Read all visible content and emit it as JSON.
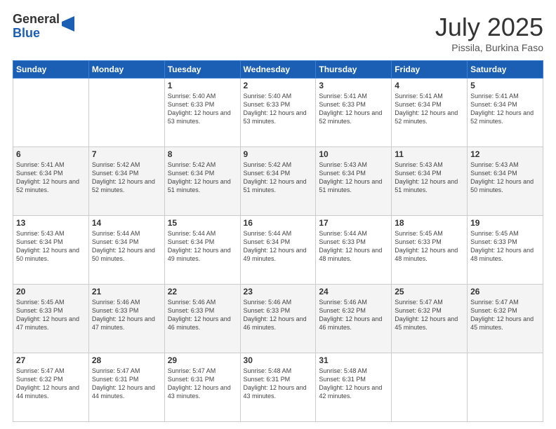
{
  "header": {
    "logo_general": "General",
    "logo_blue": "Blue",
    "month_title": "July 2025",
    "location": "Pissila, Burkina Faso"
  },
  "weekdays": [
    "Sunday",
    "Monday",
    "Tuesday",
    "Wednesday",
    "Thursday",
    "Friday",
    "Saturday"
  ],
  "weeks": [
    [
      {
        "day": "",
        "info": ""
      },
      {
        "day": "",
        "info": ""
      },
      {
        "day": "1",
        "info": "Sunrise: 5:40 AM\nSunset: 6:33 PM\nDaylight: 12 hours and 53 minutes."
      },
      {
        "day": "2",
        "info": "Sunrise: 5:40 AM\nSunset: 6:33 PM\nDaylight: 12 hours and 53 minutes."
      },
      {
        "day": "3",
        "info": "Sunrise: 5:41 AM\nSunset: 6:33 PM\nDaylight: 12 hours and 52 minutes."
      },
      {
        "day": "4",
        "info": "Sunrise: 5:41 AM\nSunset: 6:34 PM\nDaylight: 12 hours and 52 minutes."
      },
      {
        "day": "5",
        "info": "Sunrise: 5:41 AM\nSunset: 6:34 PM\nDaylight: 12 hours and 52 minutes."
      }
    ],
    [
      {
        "day": "6",
        "info": "Sunrise: 5:41 AM\nSunset: 6:34 PM\nDaylight: 12 hours and 52 minutes."
      },
      {
        "day": "7",
        "info": "Sunrise: 5:42 AM\nSunset: 6:34 PM\nDaylight: 12 hours and 52 minutes."
      },
      {
        "day": "8",
        "info": "Sunrise: 5:42 AM\nSunset: 6:34 PM\nDaylight: 12 hours and 51 minutes."
      },
      {
        "day": "9",
        "info": "Sunrise: 5:42 AM\nSunset: 6:34 PM\nDaylight: 12 hours and 51 minutes."
      },
      {
        "day": "10",
        "info": "Sunrise: 5:43 AM\nSunset: 6:34 PM\nDaylight: 12 hours and 51 minutes."
      },
      {
        "day": "11",
        "info": "Sunrise: 5:43 AM\nSunset: 6:34 PM\nDaylight: 12 hours and 51 minutes."
      },
      {
        "day": "12",
        "info": "Sunrise: 5:43 AM\nSunset: 6:34 PM\nDaylight: 12 hours and 50 minutes."
      }
    ],
    [
      {
        "day": "13",
        "info": "Sunrise: 5:43 AM\nSunset: 6:34 PM\nDaylight: 12 hours and 50 minutes."
      },
      {
        "day": "14",
        "info": "Sunrise: 5:44 AM\nSunset: 6:34 PM\nDaylight: 12 hours and 50 minutes."
      },
      {
        "day": "15",
        "info": "Sunrise: 5:44 AM\nSunset: 6:34 PM\nDaylight: 12 hours and 49 minutes."
      },
      {
        "day": "16",
        "info": "Sunrise: 5:44 AM\nSunset: 6:34 PM\nDaylight: 12 hours and 49 minutes."
      },
      {
        "day": "17",
        "info": "Sunrise: 5:44 AM\nSunset: 6:33 PM\nDaylight: 12 hours and 48 minutes."
      },
      {
        "day": "18",
        "info": "Sunrise: 5:45 AM\nSunset: 6:33 PM\nDaylight: 12 hours and 48 minutes."
      },
      {
        "day": "19",
        "info": "Sunrise: 5:45 AM\nSunset: 6:33 PM\nDaylight: 12 hours and 48 minutes."
      }
    ],
    [
      {
        "day": "20",
        "info": "Sunrise: 5:45 AM\nSunset: 6:33 PM\nDaylight: 12 hours and 47 minutes."
      },
      {
        "day": "21",
        "info": "Sunrise: 5:46 AM\nSunset: 6:33 PM\nDaylight: 12 hours and 47 minutes."
      },
      {
        "day": "22",
        "info": "Sunrise: 5:46 AM\nSunset: 6:33 PM\nDaylight: 12 hours and 46 minutes."
      },
      {
        "day": "23",
        "info": "Sunrise: 5:46 AM\nSunset: 6:33 PM\nDaylight: 12 hours and 46 minutes."
      },
      {
        "day": "24",
        "info": "Sunrise: 5:46 AM\nSunset: 6:32 PM\nDaylight: 12 hours and 46 minutes."
      },
      {
        "day": "25",
        "info": "Sunrise: 5:47 AM\nSunset: 6:32 PM\nDaylight: 12 hours and 45 minutes."
      },
      {
        "day": "26",
        "info": "Sunrise: 5:47 AM\nSunset: 6:32 PM\nDaylight: 12 hours and 45 minutes."
      }
    ],
    [
      {
        "day": "27",
        "info": "Sunrise: 5:47 AM\nSunset: 6:32 PM\nDaylight: 12 hours and 44 minutes."
      },
      {
        "day": "28",
        "info": "Sunrise: 5:47 AM\nSunset: 6:31 PM\nDaylight: 12 hours and 44 minutes."
      },
      {
        "day": "29",
        "info": "Sunrise: 5:47 AM\nSunset: 6:31 PM\nDaylight: 12 hours and 43 minutes."
      },
      {
        "day": "30",
        "info": "Sunrise: 5:48 AM\nSunset: 6:31 PM\nDaylight: 12 hours and 43 minutes."
      },
      {
        "day": "31",
        "info": "Sunrise: 5:48 AM\nSunset: 6:31 PM\nDaylight: 12 hours and 42 minutes."
      },
      {
        "day": "",
        "info": ""
      },
      {
        "day": "",
        "info": ""
      }
    ]
  ]
}
